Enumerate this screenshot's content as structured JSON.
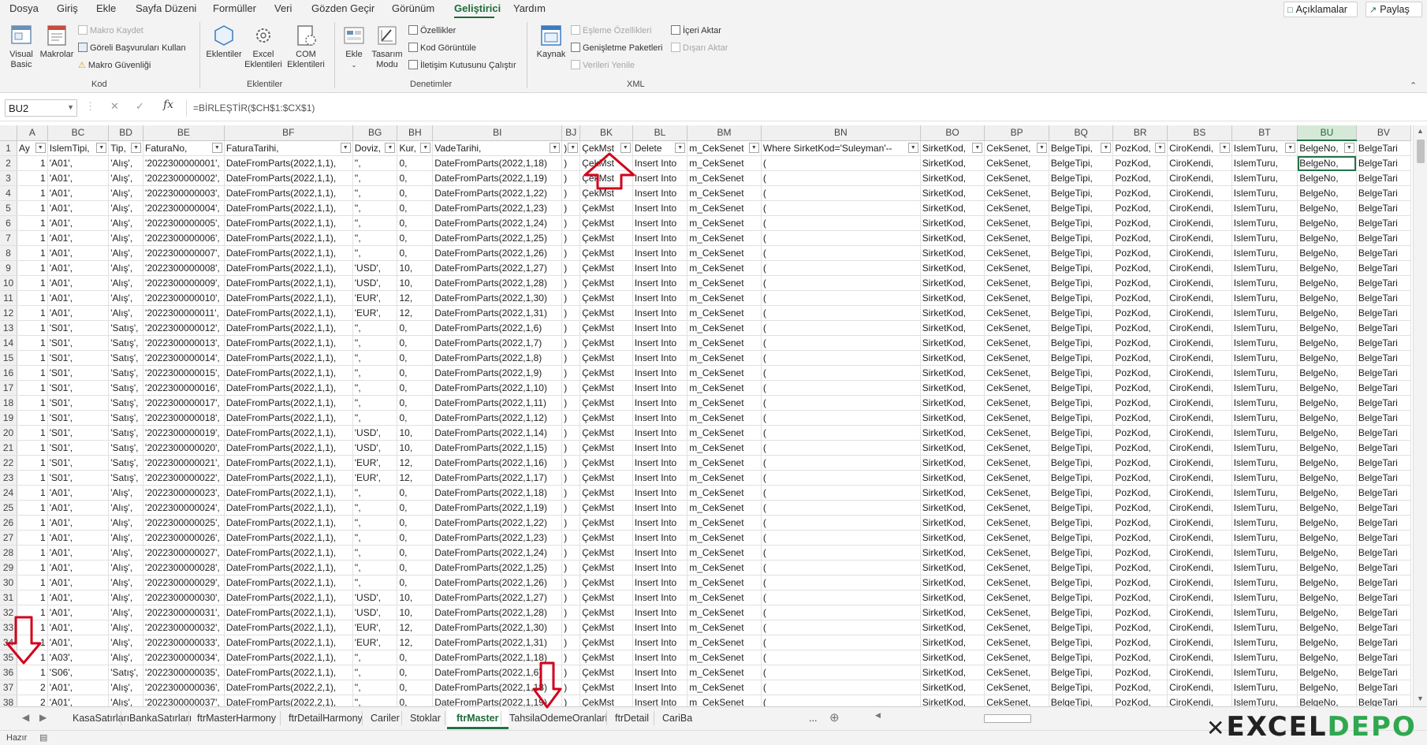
{
  "menu": {
    "items": [
      "Dosya",
      "Giriş",
      "Ekle",
      "Sayfa Düzeni",
      "Formüller",
      "Veri",
      "Gözden Geçir",
      "Görünüm",
      "Geliştirici",
      "Yardım"
    ],
    "active": "Geliştirici",
    "comments": "Açıklamalar",
    "share": "Paylaş"
  },
  "ribbon": {
    "kod": {
      "label": "Kod",
      "visual_basic": "Visual Basic",
      "makrolar": "Makrolar",
      "makro_kaydet": "Makro Kaydet",
      "goreli": "Göreli Başvuruları Kullan",
      "makro_guvenligi": "Makro Güvenliği"
    },
    "eklentiler": {
      "label": "Eklentiler",
      "eklentiler": "Eklentiler",
      "excel_eklentileri": "Excel Eklentileri",
      "com_eklentileri": "COM Eklentileri"
    },
    "denetimler": {
      "label": "Denetimler",
      "ekle": "Ekle",
      "tasarim_modu": "Tasarım Modu",
      "ozellikler": "Özellikler",
      "kod_goruntule": "Kod Görüntüle",
      "iletisim": "İletişim Kutusunu Çalıştır"
    },
    "xml": {
      "label": "XML",
      "kaynak": "Kaynak",
      "esleme": "Eşleme Özellikleri",
      "genisletme": "Genişletme Paketleri",
      "verileri_yenile": "Verileri Yenile",
      "iceri_aktar": "İçeri Aktar",
      "disari_aktar": "Dışarı Aktar"
    }
  },
  "formula_bar": {
    "name_box": "BU2",
    "formula": "=BİRLEŞTİR($CH$1:$CX$1)"
  },
  "columns": [
    {
      "letter": "A",
      "header": "Ay",
      "filter": true
    },
    {
      "letter": "BC",
      "header": "IslemTipi,",
      "filter": true
    },
    {
      "letter": "BD",
      "header": "Tip,",
      "filter": true
    },
    {
      "letter": "BE",
      "header": "FaturaNo,",
      "filter": true
    },
    {
      "letter": "BF",
      "header": "FaturaTarihi,",
      "filter": true
    },
    {
      "letter": "BG",
      "header": "Doviz,",
      "filter": true
    },
    {
      "letter": "BH",
      "header": "Kur,",
      "filter": true
    },
    {
      "letter": "BI",
      "header": "VadeTarihi,",
      "filter": true
    },
    {
      "letter": "BJ",
      "header": ")",
      "filter": true
    },
    {
      "letter": "BK",
      "header": "ÇekMst",
      "filter": true
    },
    {
      "letter": "BL",
      "header": "Delete",
      "filter": true
    },
    {
      "letter": "BM",
      "header": "m_CekSenet",
      "filter": true
    },
    {
      "letter": "BN",
      "header": "Where SirketKod='Suleyman'--",
      "filter": true
    },
    {
      "letter": "BO",
      "header": "SirketKod,",
      "filter": true
    },
    {
      "letter": "BP",
      "header": "CekSenet,",
      "filter": true
    },
    {
      "letter": "BQ",
      "header": "BelgeTipi,",
      "filter": true
    },
    {
      "letter": "BR",
      "header": "PozKod,",
      "filter": true
    },
    {
      "letter": "BS",
      "header": "CiroKendi,",
      "filter": true
    },
    {
      "letter": "BT",
      "header": "IslemTuru,",
      "filter": true
    },
    {
      "letter": "BU",
      "header": "BelgeNo,",
      "filter": true
    },
    {
      "letter": "BV",
      "header": "BelgeTari",
      "filter": false
    }
  ],
  "selected_column": "BU",
  "rows": [
    {
      "n": "2",
      "ay": "1",
      "it": "'A01',",
      "tip": "'Alış',",
      "fno": "'2022300000001',",
      "ftar": "DateFromParts(2022,1,1),",
      "dov": "'',",
      "kur": "0,",
      "vade": "DateFromParts(2022,1,18)"
    },
    {
      "n": "3",
      "ay": "1",
      "it": "'A01',",
      "tip": "'Alış',",
      "fno": "'2022300000002',",
      "ftar": "DateFromParts(2022,1,1),",
      "dov": "'',",
      "kur": "0,",
      "vade": "DateFromParts(2022,1,19)"
    },
    {
      "n": "4",
      "ay": "1",
      "it": "'A01',",
      "tip": "'Alış',",
      "fno": "'2022300000003',",
      "ftar": "DateFromParts(2022,1,1),",
      "dov": "'',",
      "kur": "0,",
      "vade": "DateFromParts(2022,1,22)"
    },
    {
      "n": "5",
      "ay": "1",
      "it": "'A01',",
      "tip": "'Alış',",
      "fno": "'2022300000004',",
      "ftar": "DateFromParts(2022,1,1),",
      "dov": "'',",
      "kur": "0,",
      "vade": "DateFromParts(2022,1,23)"
    },
    {
      "n": "6",
      "ay": "1",
      "it": "'A01',",
      "tip": "'Alış',",
      "fno": "'2022300000005',",
      "ftar": "DateFromParts(2022,1,1),",
      "dov": "'',",
      "kur": "0,",
      "vade": "DateFromParts(2022,1,24)"
    },
    {
      "n": "7",
      "ay": "1",
      "it": "'A01',",
      "tip": "'Alış',",
      "fno": "'2022300000006',",
      "ftar": "DateFromParts(2022,1,1),",
      "dov": "'',",
      "kur": "0,",
      "vade": "DateFromParts(2022,1,25)"
    },
    {
      "n": "8",
      "ay": "1",
      "it": "'A01',",
      "tip": "'Alış',",
      "fno": "'2022300000007',",
      "ftar": "DateFromParts(2022,1,1),",
      "dov": "'',",
      "kur": "0,",
      "vade": "DateFromParts(2022,1,26)"
    },
    {
      "n": "9",
      "ay": "1",
      "it": "'A01',",
      "tip": "'Alış',",
      "fno": "'2022300000008',",
      "ftar": "DateFromParts(2022,1,1),",
      "dov": "'USD',",
      "kur": "10,",
      "vade": "DateFromParts(2022,1,27)"
    },
    {
      "n": "10",
      "ay": "1",
      "it": "'A01',",
      "tip": "'Alış',",
      "fno": "'2022300000009',",
      "ftar": "DateFromParts(2022,1,1),",
      "dov": "'USD',",
      "kur": "10,",
      "vade": "DateFromParts(2022,1,28)"
    },
    {
      "n": "11",
      "ay": "1",
      "it": "'A01',",
      "tip": "'Alış',",
      "fno": "'2022300000010',",
      "ftar": "DateFromParts(2022,1,1),",
      "dov": "'EUR',",
      "kur": "12,",
      "vade": "DateFromParts(2022,1,30)"
    },
    {
      "n": "12",
      "ay": "1",
      "it": "'A01',",
      "tip": "'Alış',",
      "fno": "'2022300000011',",
      "ftar": "DateFromParts(2022,1,1),",
      "dov": "'EUR',",
      "kur": "12,",
      "vade": "DateFromParts(2022,1,31)"
    },
    {
      "n": "13",
      "ay": "1",
      "it": "'S01',",
      "tip": "'Satış',",
      "fno": "'2022300000012',",
      "ftar": "DateFromParts(2022,1,1),",
      "dov": "'',",
      "kur": "0,",
      "vade": "DateFromParts(2022,1,6)"
    },
    {
      "n": "14",
      "ay": "1",
      "it": "'S01',",
      "tip": "'Satış',",
      "fno": "'2022300000013',",
      "ftar": "DateFromParts(2022,1,1),",
      "dov": "'',",
      "kur": "0,",
      "vade": "DateFromParts(2022,1,7)"
    },
    {
      "n": "15",
      "ay": "1",
      "it": "'S01',",
      "tip": "'Satış',",
      "fno": "'2022300000014',",
      "ftar": "DateFromParts(2022,1,1),",
      "dov": "'',",
      "kur": "0,",
      "vade": "DateFromParts(2022,1,8)"
    },
    {
      "n": "16",
      "ay": "1",
      "it": "'S01',",
      "tip": "'Satış',",
      "fno": "'2022300000015',",
      "ftar": "DateFromParts(2022,1,1),",
      "dov": "'',",
      "kur": "0,",
      "vade": "DateFromParts(2022,1,9)"
    },
    {
      "n": "17",
      "ay": "1",
      "it": "'S01',",
      "tip": "'Satış',",
      "fno": "'2022300000016',",
      "ftar": "DateFromParts(2022,1,1),",
      "dov": "'',",
      "kur": "0,",
      "vade": "DateFromParts(2022,1,10)"
    },
    {
      "n": "18",
      "ay": "1",
      "it": "'S01',",
      "tip": "'Satış',",
      "fno": "'2022300000017',",
      "ftar": "DateFromParts(2022,1,1),",
      "dov": "'',",
      "kur": "0,",
      "vade": "DateFromParts(2022,1,11)"
    },
    {
      "n": "19",
      "ay": "1",
      "it": "'S01',",
      "tip": "'Satış',",
      "fno": "'2022300000018',",
      "ftar": "DateFromParts(2022,1,1),",
      "dov": "'',",
      "kur": "0,",
      "vade": "DateFromParts(2022,1,12)"
    },
    {
      "n": "20",
      "ay": "1",
      "it": "'S01',",
      "tip": "'Satış',",
      "fno": "'2022300000019',",
      "ftar": "DateFromParts(2022,1,1),",
      "dov": "'USD',",
      "kur": "10,",
      "vade": "DateFromParts(2022,1,14)"
    },
    {
      "n": "21",
      "ay": "1",
      "it": "'S01',",
      "tip": "'Satış',",
      "fno": "'2022300000020',",
      "ftar": "DateFromParts(2022,1,1),",
      "dov": "'USD',",
      "kur": "10,",
      "vade": "DateFromParts(2022,1,15)"
    },
    {
      "n": "22",
      "ay": "1",
      "it": "'S01',",
      "tip": "'Satış',",
      "fno": "'2022300000021',",
      "ftar": "DateFromParts(2022,1,1),",
      "dov": "'EUR',",
      "kur": "12,",
      "vade": "DateFromParts(2022,1,16)"
    },
    {
      "n": "23",
      "ay": "1",
      "it": "'S01',",
      "tip": "'Satış',",
      "fno": "'2022300000022',",
      "ftar": "DateFromParts(2022,1,1),",
      "dov": "'EUR',",
      "kur": "12,",
      "vade": "DateFromParts(2022,1,17)"
    },
    {
      "n": "24",
      "ay": "1",
      "it": "'A01',",
      "tip": "'Alış',",
      "fno": "'2022300000023',",
      "ftar": "DateFromParts(2022,1,1),",
      "dov": "'',",
      "kur": "0,",
      "vade": "DateFromParts(2022,1,18)"
    },
    {
      "n": "25",
      "ay": "1",
      "it": "'A01',",
      "tip": "'Alış',",
      "fno": "'2022300000024',",
      "ftar": "DateFromParts(2022,1,1),",
      "dov": "'',",
      "kur": "0,",
      "vade": "DateFromParts(2022,1,19)"
    },
    {
      "n": "26",
      "ay": "1",
      "it": "'A01',",
      "tip": "'Alış',",
      "fno": "'2022300000025',",
      "ftar": "DateFromParts(2022,1,1),",
      "dov": "'',",
      "kur": "0,",
      "vade": "DateFromParts(2022,1,22)"
    },
    {
      "n": "27",
      "ay": "1",
      "it": "'A01',",
      "tip": "'Alış',",
      "fno": "'2022300000026',",
      "ftar": "DateFromParts(2022,1,1),",
      "dov": "'',",
      "kur": "0,",
      "vade": "DateFromParts(2022,1,23)"
    },
    {
      "n": "28",
      "ay": "1",
      "it": "'A01',",
      "tip": "'Alış',",
      "fno": "'2022300000027',",
      "ftar": "DateFromParts(2022,1,1),",
      "dov": "'',",
      "kur": "0,",
      "vade": "DateFromParts(2022,1,24)"
    },
    {
      "n": "29",
      "ay": "1",
      "it": "'A01',",
      "tip": "'Alış',",
      "fno": "'2022300000028',",
      "ftar": "DateFromParts(2022,1,1),",
      "dov": "'',",
      "kur": "0,",
      "vade": "DateFromParts(2022,1,25)"
    },
    {
      "n": "30",
      "ay": "1",
      "it": "'A01',",
      "tip": "'Alış',",
      "fno": "'2022300000029',",
      "ftar": "DateFromParts(2022,1,1),",
      "dov": "'',",
      "kur": "0,",
      "vade": "DateFromParts(2022,1,26)"
    },
    {
      "n": "31",
      "ay": "1",
      "it": "'A01',",
      "tip": "'Alış',",
      "fno": "'2022300000030',",
      "ftar": "DateFromParts(2022,1,1),",
      "dov": "'USD',",
      "kur": "10,",
      "vade": "DateFromParts(2022,1,27)"
    },
    {
      "n": "32",
      "ay": "1",
      "it": "'A01',",
      "tip": "'Alış',",
      "fno": "'2022300000031',",
      "ftar": "DateFromParts(2022,1,1),",
      "dov": "'USD',",
      "kur": "10,",
      "vade": "DateFromParts(2022,1,28)"
    },
    {
      "n": "33",
      "ay": "1",
      "it": "'A01',",
      "tip": "'Alış',",
      "fno": "'2022300000032',",
      "ftar": "DateFromParts(2022,1,1),",
      "dov": "'EUR',",
      "kur": "12,",
      "vade": "DateFromParts(2022,1,30)"
    },
    {
      "n": "34",
      "ay": "1",
      "it": "'A01',",
      "tip": "'Alış',",
      "fno": "'2022300000033',",
      "ftar": "DateFromParts(2022,1,1),",
      "dov": "'EUR',",
      "kur": "12,",
      "vade": "DateFromParts(2022,1,31)"
    },
    {
      "n": "35",
      "ay": "1",
      "it": "'A03',",
      "tip": "'Alış',",
      "fno": "'2022300000034',",
      "ftar": "DateFromParts(2022,1,1),",
      "dov": "'',",
      "kur": "0,",
      "vade": "DateFromParts(2022,1,18)"
    },
    {
      "n": "36",
      "ay": "1",
      "it": "'S06',",
      "tip": "'Satış',",
      "fno": "'2022300000035',",
      "ftar": "DateFromParts(2022,1,1),",
      "dov": "'',",
      "kur": "0,",
      "vade": "DateFromParts(2022,1,6)"
    },
    {
      "n": "37",
      "ay": "2",
      "it": "'A01',",
      "tip": "'Alış',",
      "fno": "'2022300000036',",
      "ftar": "DateFromParts(2022,2,1),",
      "dov": "'',",
      "kur": "0,",
      "vade": "DateFromParts(2022,1,18)"
    },
    {
      "n": "38",
      "ay": "2",
      "it": "'A01',",
      "tip": "'Alış',",
      "fno": "'2022300000037',",
      "ftar": "DateFromParts(2022,2,1),",
      "dov": "'',",
      "kur": "0,",
      "vade": "DateFromParts(2022,1,19)"
    }
  ],
  "repeat_values": {
    "bj": ")",
    "bk": "ÇekMst",
    "bl": "Insert Into",
    "bm": "m_CekSenet",
    "bn": "(",
    "bo": "SirketKod,",
    "bp": "CekSenet,",
    "bq": "BelgeTipi,",
    "br": "PozKod,",
    "bs": "CiroKendi,",
    "bt": "IslemTuru,",
    "bu": "BelgeNo,",
    "bv": "BelgeTari"
  },
  "sheet_tabs": [
    "KasaSatırları",
    "BankaSatırları",
    "ftrMasterHarmony",
    "ftrDetailHarmony",
    "Cariler",
    "Stoklar",
    "ftrMaster",
    "TahsilaOdemeOranlari",
    "ftrDetail",
    "CariBa"
  ],
  "active_tab": "ftrMaster",
  "tabs_more": "...",
  "status": {
    "ready": "Hazır"
  },
  "brand": {
    "part1": "EXCEL",
    "part2": "DEPO"
  },
  "colors": {
    "accent": "#217346",
    "arrow": "#d0021b"
  }
}
